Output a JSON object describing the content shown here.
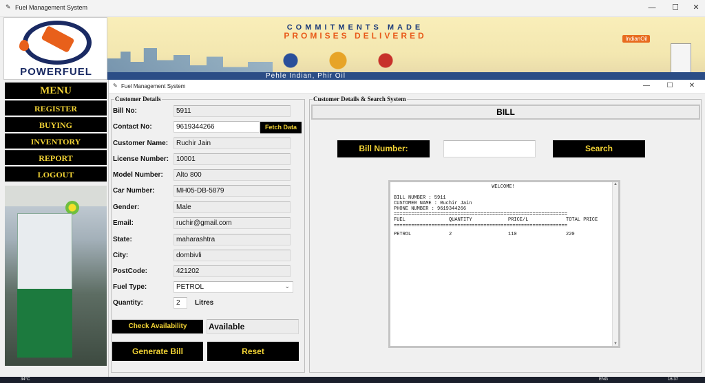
{
  "outer_window": {
    "title": "Fuel Management System"
  },
  "logo": {
    "text": "POWERFUEL"
  },
  "banner": {
    "line1": "COMMITMENTS MADE",
    "line2": "PROMISES DELIVERED",
    "tagline": "Pehle Indian, Phir Oil",
    "brand": "IndianOil"
  },
  "menu": {
    "title": "MENU",
    "items": [
      "REGISTER",
      "BUYING",
      "INVENTORY",
      "REPORT",
      "LOGOUT"
    ]
  },
  "inner_window": {
    "title": "Fuel Management System"
  },
  "customer": {
    "group_title": "Customer Details",
    "bill_no_label": "Bill No:",
    "bill_no": "5911",
    "contact_label": "Contact No:",
    "contact": "9619344266",
    "fetch_label": "Fetch Data",
    "name_label": "Customer Name:",
    "name": "Ruchir Jain",
    "license_label": "License Number:",
    "license": "10001",
    "model_label": "Model Number:",
    "model": "Alto 800",
    "car_label": "Car Number:",
    "car": "MH05-DB-5879",
    "gender_label": "Gender:",
    "gender": "Male",
    "email_label": "Email:",
    "email": "ruchir@gmail.com",
    "state_label": "State:",
    "state": "maharashtra",
    "city_label": "City:",
    "city": "dombivli",
    "postcode_label": "PostCode:",
    "postcode": "421202",
    "fuel_label": "Fuel Type:",
    "fuel": "PETROL",
    "quantity_label": "Quantity:",
    "quantity": "2",
    "litres_label": "Litres",
    "check_label": "Check Availability",
    "availability": "Available",
    "generate_label": "Generate Bill",
    "reset_label": "Reset"
  },
  "search": {
    "group_title": "Customer Details & Search System",
    "header": "BILL",
    "bill_number_label": "Bill Number:",
    "bill_number_value": "",
    "search_label": "Search"
  },
  "bill": {
    "welcome": "WELCOME!",
    "bill_number_line": "BILL NUMBER : 5911",
    "customer_name_line": "CUSTOMER NAME : Ruchir Jain",
    "phone_line": "PHONE NUMBER : 9619344266",
    "sep": "============================================================",
    "col_fuel": "FUEL",
    "col_qty": "QUANTITY",
    "col_price": "PRICE/L",
    "col_total": "TOTAL PRICE",
    "row_fuel": "PETROL",
    "row_qty": "2",
    "row_price": "110",
    "row_total": "220"
  },
  "taskbar": {
    "temp": "34°C",
    "lang": "ENG",
    "time": "16:37"
  },
  "colors": {
    "accent_yellow": "#f2d335",
    "button_black": "#000000",
    "logo_navy": "#1a2a63",
    "logo_orange": "#e8601b"
  }
}
